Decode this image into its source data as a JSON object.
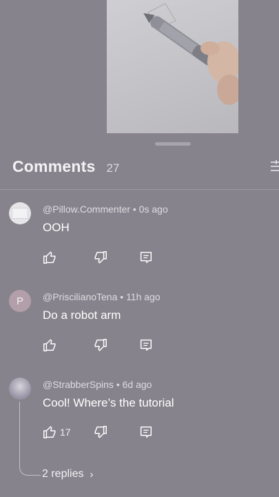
{
  "header": {
    "title": "Comments",
    "count": "27"
  },
  "comments": [
    {
      "author": "@Pillow.Commenter",
      "time": "0s ago",
      "text": "OOH",
      "likes": ""
    },
    {
      "author": "@PriscilianoTena",
      "time": "11h ago",
      "text": "Do a robot arm",
      "avatar_letter": "P",
      "likes": ""
    },
    {
      "author": "@StrabberSpins",
      "time": "6d ago",
      "text": "Cool! Where’s the tutorial",
      "likes": "17",
      "replies_label": "2 replies"
    }
  ],
  "icons": {
    "like": "thumbs-up-icon",
    "dislike": "thumbs-down-icon",
    "reply": "reply-icon",
    "filter": "filter-icon",
    "chevron": "chevron-right-icon"
  },
  "separator": " • "
}
